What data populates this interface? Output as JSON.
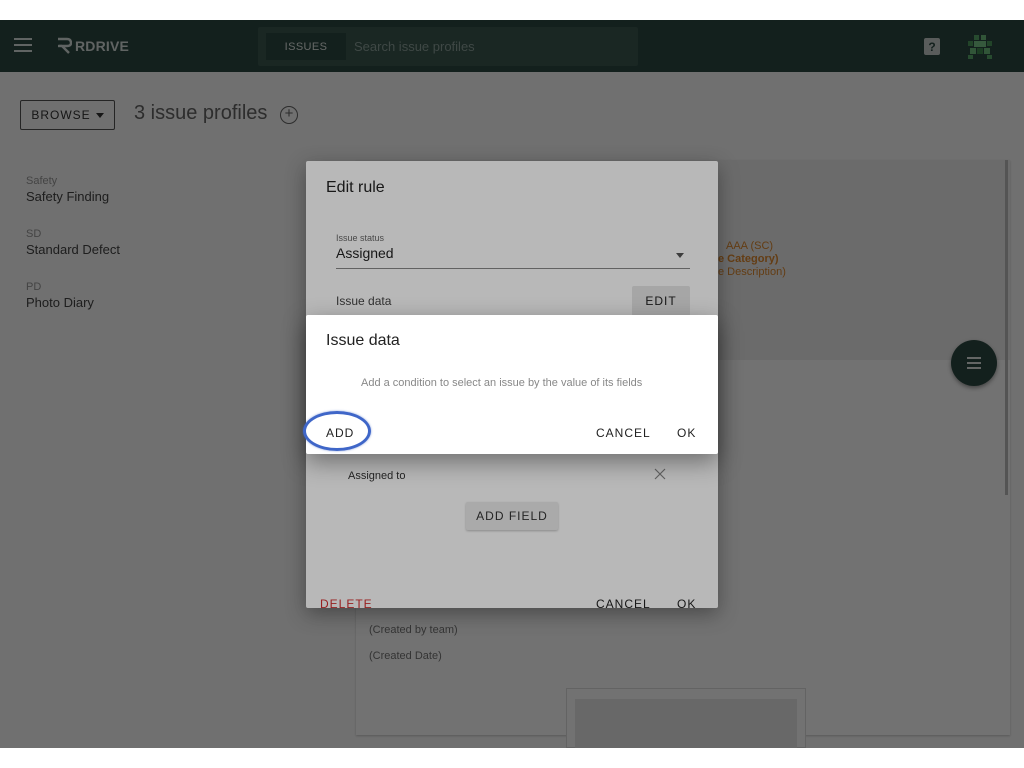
{
  "app": {
    "logo_text": "RDRIVE"
  },
  "search": {
    "tab_label": "ISSUES",
    "placeholder": "Search issue profiles"
  },
  "header": {
    "help_label": "?",
    "browse_label": "BROWSE",
    "title": "3 issue profiles",
    "add_label": "+"
  },
  "profiles": [
    {
      "code": "Safety",
      "name": "Safety Finding"
    },
    {
      "code": "SD",
      "name": "Standard Defect"
    },
    {
      "code": "PD",
      "name": "Photo Diary"
    }
  ],
  "background": {
    "orange_lines": [
      "AAA (SC)",
      "e Category)",
      "e Description)"
    ],
    "fields": [
      "(Created by team)",
      "(Created Date)"
    ]
  },
  "edit_dialog": {
    "title": "Edit rule",
    "status_label": "Issue status",
    "status_value": "Assigned",
    "issue_data_label": "Issue data",
    "edit_label": "EDIT",
    "assigned_to": "Assigned to",
    "add_field_label": "ADD FIELD",
    "delete_label": "DELETE",
    "cancel_label": "CANCEL",
    "ok_label": "OK"
  },
  "data_dialog": {
    "title": "Issue data",
    "description": "Add a condition to select an issue by the value of its fields",
    "add_label": "ADD",
    "cancel_label": "CANCEL",
    "ok_label": "OK"
  },
  "colors": {
    "topbar": "#2d4a43",
    "accent_orange": "#e08a2e",
    "delete_red": "#d32f2f",
    "highlight_blue": "#3f66c8"
  }
}
